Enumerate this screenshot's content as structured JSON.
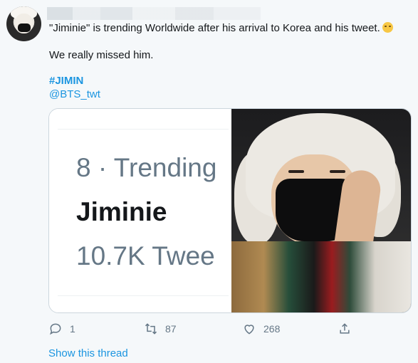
{
  "tweet": {
    "text_line1": "\"Jiminie\" is trending Worldwide after his arrival to Korea and his tweet.",
    "emoji_icon": "sweat-smile-emoji-icon",
    "text_line2": "We really missed him.",
    "hashtag": "#JIMIN",
    "mention": "@BTS_twt"
  },
  "media": {
    "trend_rank": "8 · Trending",
    "trend_name": "Jiminie",
    "trend_count": "10.7K Twee"
  },
  "actions": {
    "reply_count": "1",
    "retweet_count": "87",
    "like_count": "268"
  },
  "show_thread": "Show this thread",
  "colors": {
    "link": "#1b95e0",
    "muted": "#657786",
    "background": "#f5f8fa"
  }
}
